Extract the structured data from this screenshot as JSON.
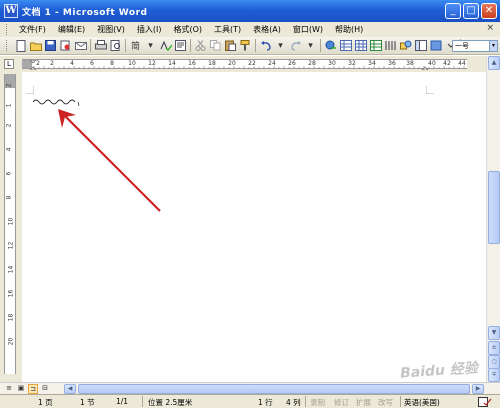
{
  "window": {
    "title": "文档 1 - Microsoft Word",
    "app_icon": "W",
    "controls": {
      "minimize": "_",
      "maximize": "□",
      "close": "✕"
    }
  },
  "menu": {
    "items": [
      "文件(F)",
      "编辑(E)",
      "视图(V)",
      "插入(I)",
      "格式(O)",
      "工具(T)",
      "表格(A)",
      "窗口(W)",
      "帮助(H)"
    ],
    "close_glyph": "×"
  },
  "toolbar": {
    "simplified_label": "简",
    "font_size": "一号",
    "dropdown_glyph": "▾"
  },
  "ruler": {
    "corner_glyph": "L",
    "horizontal_ticks": [
      "2",
      "2",
      "4",
      "6",
      "8",
      "10",
      "12",
      "14",
      "16",
      "18",
      "20",
      "22",
      "24",
      "26",
      "28",
      "30",
      "32",
      "34",
      "36",
      "38",
      "40",
      "42",
      "44"
    ],
    "vertical_ticks": [
      "2",
      "1",
      "2",
      "4",
      "6",
      "8",
      "10",
      "12",
      "14",
      "16",
      "18",
      "20"
    ]
  },
  "scrollbar": {
    "up": "▲",
    "down": "▼",
    "prev_page": "±",
    "select_browse": "○",
    "next_page": "∓",
    "left": "◀",
    "right": "▶"
  },
  "view_buttons": [
    "≡",
    "▣",
    "⊐",
    "⊟"
  ],
  "statusbar": {
    "page": "1 页",
    "section": "1 节",
    "page_of": "1/1",
    "position": "位置 2.5厘米",
    "line": "1 行",
    "column": "4 列",
    "rec": "录制",
    "trk": "修订",
    "ext": "扩展",
    "ovr": "改写",
    "language": "英语(美国)"
  },
  "watermark": "Baidu 经验",
  "colors": {
    "titlebar": "#1f5fd6",
    "chrome": "#ece9d8",
    "arrow": "#cc2222"
  }
}
